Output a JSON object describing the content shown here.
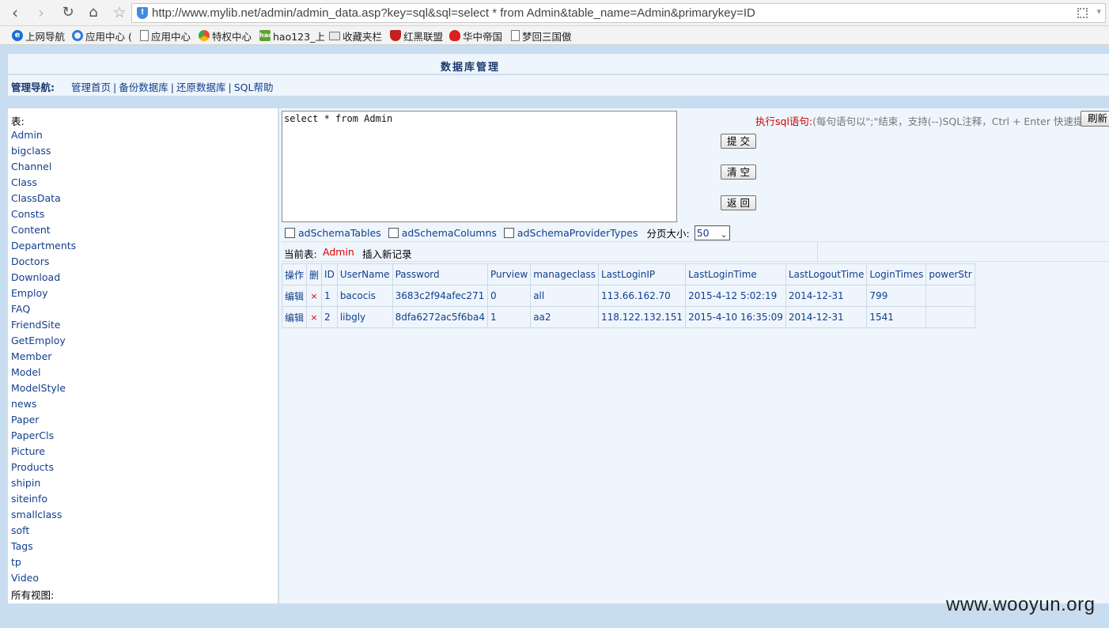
{
  "browser": {
    "url": "http://www.mylib.net/admin/admin_data.asp?key=sql&sql=select * from Admin&table_name=Admin&primarykey=ID",
    "bookmarks": [
      {
        "label": "上网导航",
        "icon": "ie-icon"
      },
      {
        "label": "应用中心 (",
        "icon": "ring-icon"
      },
      {
        "label": "应用中心",
        "icon": "page-icon"
      },
      {
        "label": "特权中心",
        "icon": "chrome-icon"
      },
      {
        "label": "hao123_上",
        "icon": "hao123-icon"
      },
      {
        "label": "收藏夹栏",
        "icon": "folder-icon"
      },
      {
        "label": "红黑联盟",
        "icon": "shield-red-icon"
      },
      {
        "label": "华中帝国",
        "icon": "flame-icon"
      },
      {
        "label": "梦回三国傲",
        "icon": "page-icon"
      }
    ]
  },
  "header": {
    "title": "数据库管理",
    "nav_label": "管理导航:",
    "nav_links": [
      "管理首页",
      "备份数据库",
      "还原数据库",
      "SQL帮助"
    ]
  },
  "sidebar": {
    "tables_label": "表:",
    "tables": [
      "Admin",
      "bigclass",
      "Channel",
      "Class",
      "ClassData",
      "Consts",
      "Content",
      "Departments",
      "Doctors",
      "Download",
      "Employ",
      "FAQ",
      "FriendSite",
      "GetEmploy",
      "Member",
      "Model",
      "ModelStyle",
      "news",
      "Paper",
      "PaperCls",
      "Picture",
      "Products",
      "shipin",
      "siteinfo",
      "smallclass",
      "soft",
      "Tags",
      "tp",
      "Video"
    ],
    "views_label": "所有视图:"
  },
  "sql": {
    "query": "select * from Admin",
    "label": "执行sql语句:",
    "hint": "(每句语句以\";\"结束，支持(--)SQL注释，Ctrl + Enter 快速提交)",
    "refresh_label": "刷新",
    "submit_label": "提 交",
    "clear_label": "清 空",
    "back_label": "返 回"
  },
  "options": {
    "checkboxes": [
      "adSchemaTables",
      "adSchemaColumns",
      "adSchemaProviderTypes"
    ],
    "page_size_label": "分页大小:",
    "page_size": "50"
  },
  "current": {
    "label": "当前表:",
    "table": "Admin",
    "insert_label": "插入新记录"
  },
  "results": {
    "columns": [
      "操作",
      "删",
      "ID",
      "UserName",
      "Password",
      "Purview",
      "manageclass",
      "LastLoginIP",
      "LastLoginTime",
      "LastLogoutTime",
      "LoginTimes",
      "powerStr"
    ],
    "rows": [
      [
        "编辑",
        "×",
        "1",
        "bacocis",
        "3683c2f94afec271",
        "0",
        "all",
        "113.66.162.70",
        "2015-4-12 5:02:19",
        "2014-12-31",
        "799",
        ""
      ],
      [
        "编辑",
        "×",
        "2",
        "libgly",
        "8dfa6272ac5f6ba4",
        "1",
        "aa2",
        "118.122.132.151",
        "2015-4-10 16:35:09",
        "2014-12-31",
        "1541",
        ""
      ]
    ]
  },
  "watermark": "www.wooyun.org"
}
